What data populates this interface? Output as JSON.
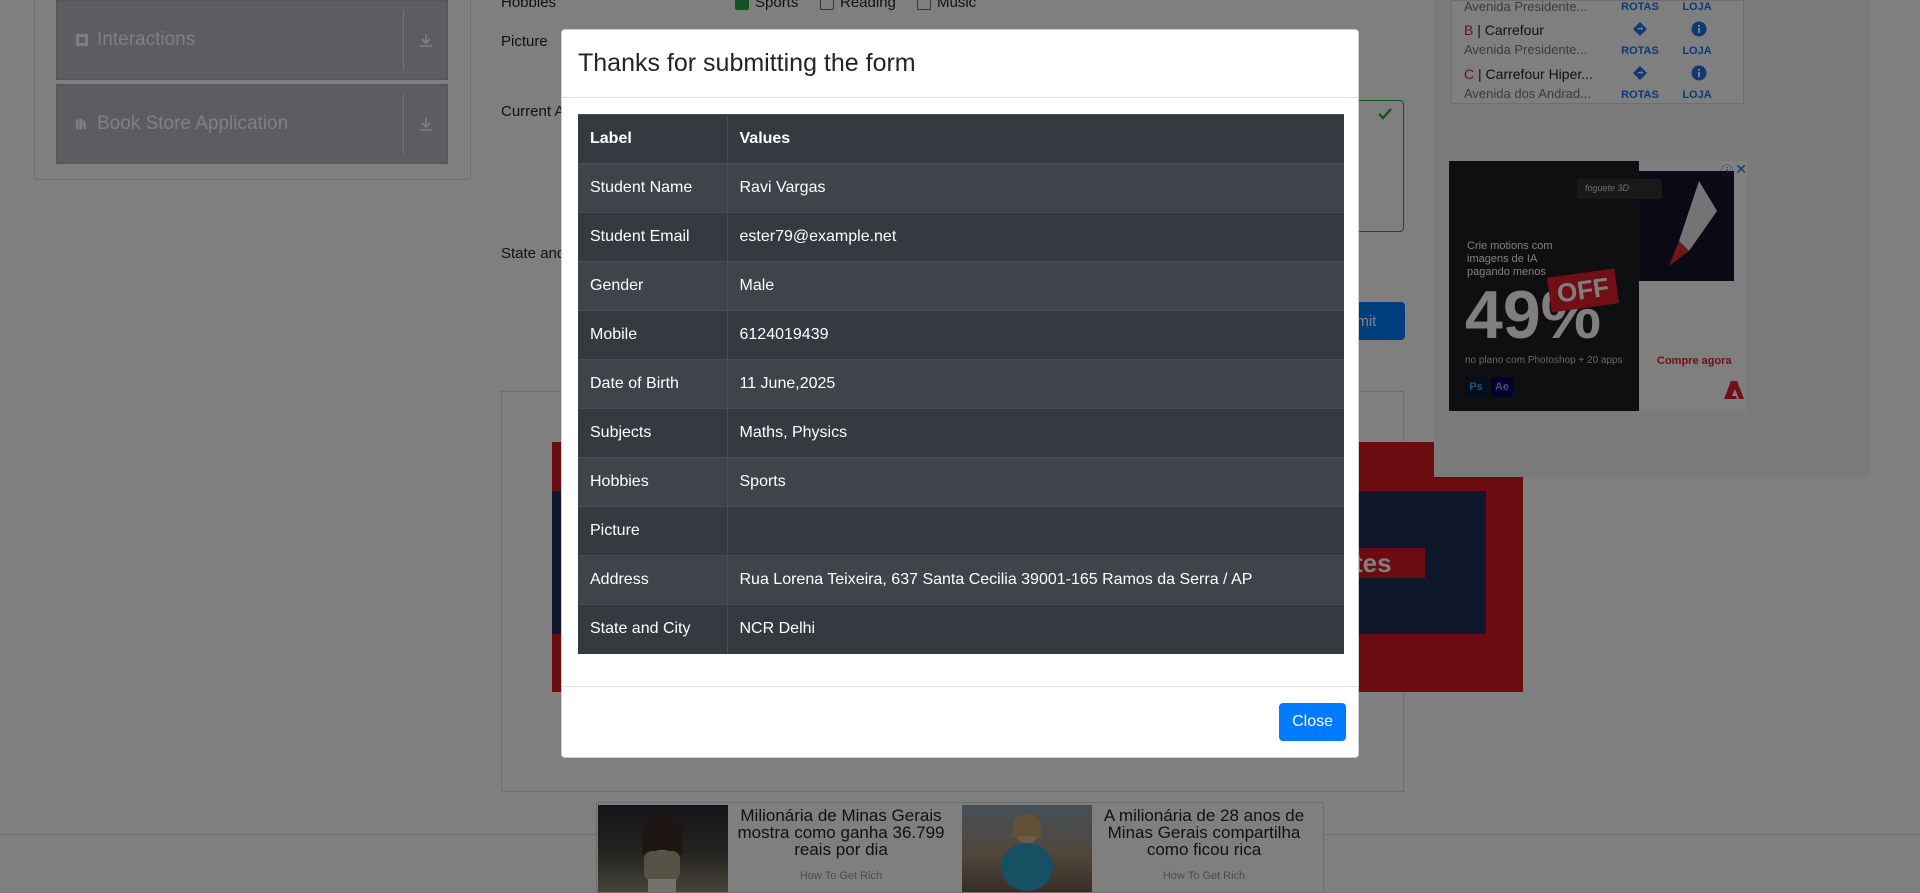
{
  "sidebar": {
    "items": [
      {
        "label": "Interactions",
        "icon": "interactions-icon"
      },
      {
        "label": "Book Store Application",
        "icon": "book-icon"
      }
    ]
  },
  "form": {
    "hobbies_label": "Hobbies",
    "hobby_options": [
      "Sports",
      "Reading",
      "Music"
    ],
    "picture_label": "Picture",
    "current_address_label": "Current A",
    "state_city_label": "State and",
    "submit_label": "bmit"
  },
  "map_ad": {
    "rows": [
      {
        "letter": "",
        "name": "",
        "address": "Avenida Presidente..."
      },
      {
        "letter": "B",
        "name": "Carrefour",
        "address": "Avenida Presidente..."
      },
      {
        "letter": "C",
        "name": "Carrefour Hiper...",
        "address": "Avenida dos Andrad..."
      }
    ],
    "route_label": "ROTAS",
    "store_label": "LOJA"
  },
  "adobe_ad": {
    "foguete": "foguete 3D",
    "text": "Crie motions com imagens de IA pagando menos",
    "percent": "49%",
    "off": "OFF",
    "plan": "no plano com Photoshop + 20 apps",
    "cta": "Compre agora",
    "ps": "Ps",
    "ae": "Ae"
  },
  "banner_ad": {
    "tag": "tes"
  },
  "bottom_ad": {
    "items": [
      {
        "headline": "Milionária de Minas Gerais mostra como ganha 36.799 reais por dia",
        "source": "How To Get Rich"
      },
      {
        "headline": "A milionária de 28 anos de Minas Gerais compartilha como ficou rica",
        "source": "How To Get Rich"
      }
    ]
  },
  "modal": {
    "title": "Thanks for submitting the form",
    "headers": [
      "Label",
      "Values"
    ],
    "rows": [
      {
        "label": "Student Name",
        "value": "Ravi Vargas"
      },
      {
        "label": "Student Email",
        "value": "ester79@example.net"
      },
      {
        "label": "Gender",
        "value": "Male"
      },
      {
        "label": "Mobile",
        "value": "6124019439"
      },
      {
        "label": "Date of Birth",
        "value": "11 June,2025"
      },
      {
        "label": "Subjects",
        "value": "Maths, Physics"
      },
      {
        "label": "Hobbies",
        "value": "Sports"
      },
      {
        "label": "Picture",
        "value": ""
      },
      {
        "label": "Address",
        "value": "Rua Lorena Teixeira, 637 Santa Cecilia 39001-165 Ramos da Serra / AP"
      },
      {
        "label": "State and City",
        "value": "NCR Delhi"
      }
    ],
    "close_label": "Close"
  },
  "colors": {
    "primary": "#007bff",
    "table_dark": "#343a40",
    "success": "#28a745",
    "backdrop": "rgba(0,0,0,0.5)"
  }
}
